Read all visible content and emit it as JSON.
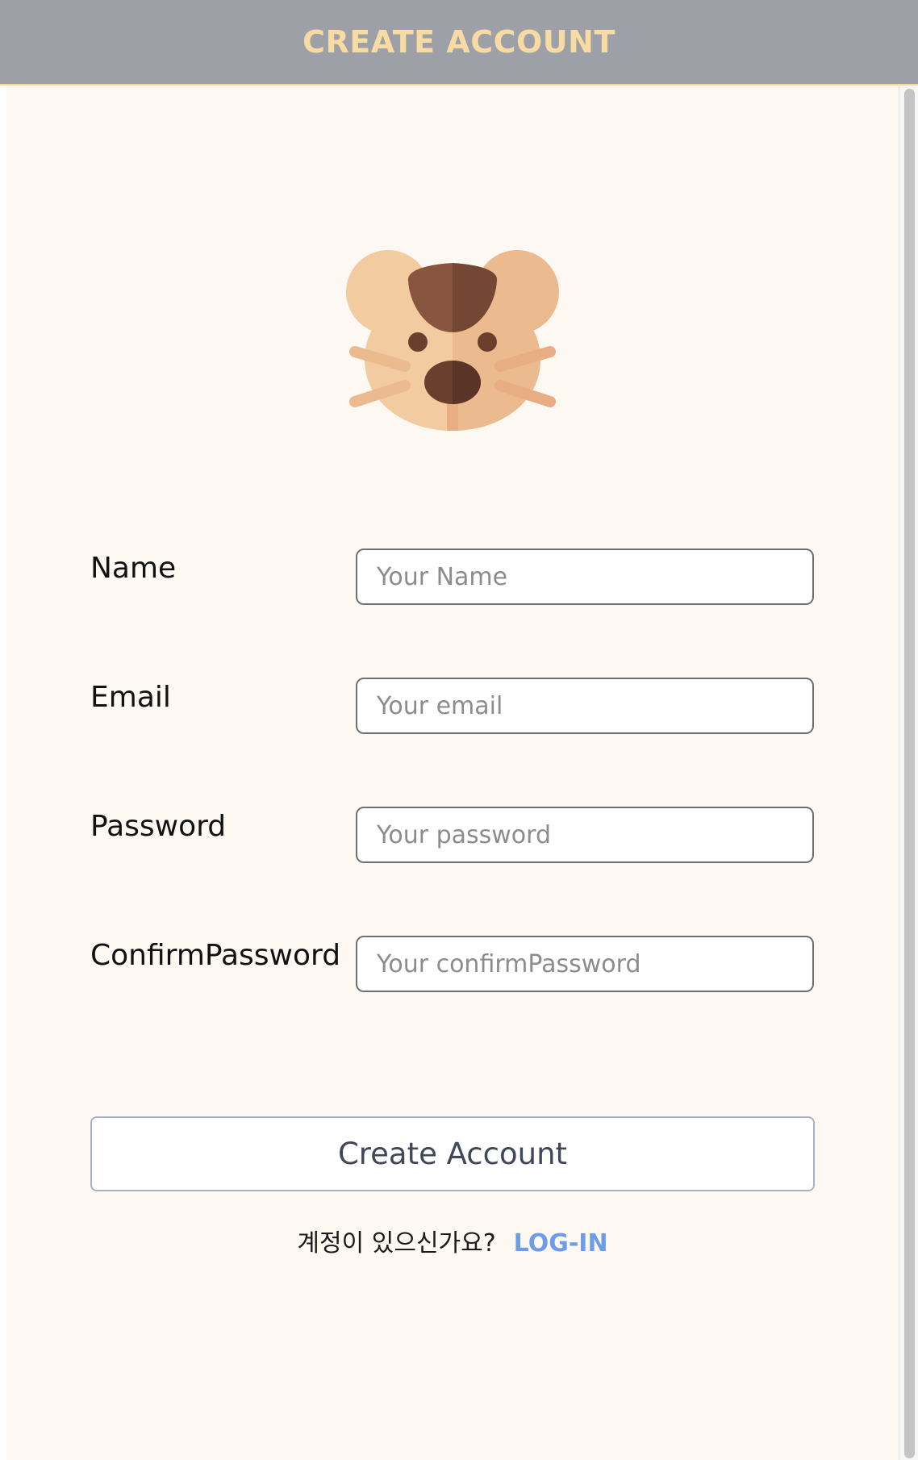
{
  "header": {
    "title": "CREATE ACCOUNT",
    "background": "#9ea0a7",
    "title_color": "#f8dba3"
  },
  "logo": {
    "icon": "hamster-icon"
  },
  "form": {
    "name": {
      "label": "Name",
      "placeholder": "Your Name",
      "value": ""
    },
    "email": {
      "label": "Email",
      "placeholder": "Your email",
      "value": ""
    },
    "password": {
      "label": "Password",
      "placeholder": "Your password",
      "value": ""
    },
    "confirm_password": {
      "label": "ConfirmPassword",
      "placeholder": "Your confirmPassword",
      "value": ""
    },
    "submit_label": "Create Account"
  },
  "footer": {
    "prompt": "계정이 있으신가요?",
    "login_link": "LOG-IN",
    "link_color": "#6f9ce6"
  },
  "colors": {
    "page_background": "#fdf8f2",
    "input_border": "#6f6f6f",
    "button_border": "#a8b0c4"
  }
}
